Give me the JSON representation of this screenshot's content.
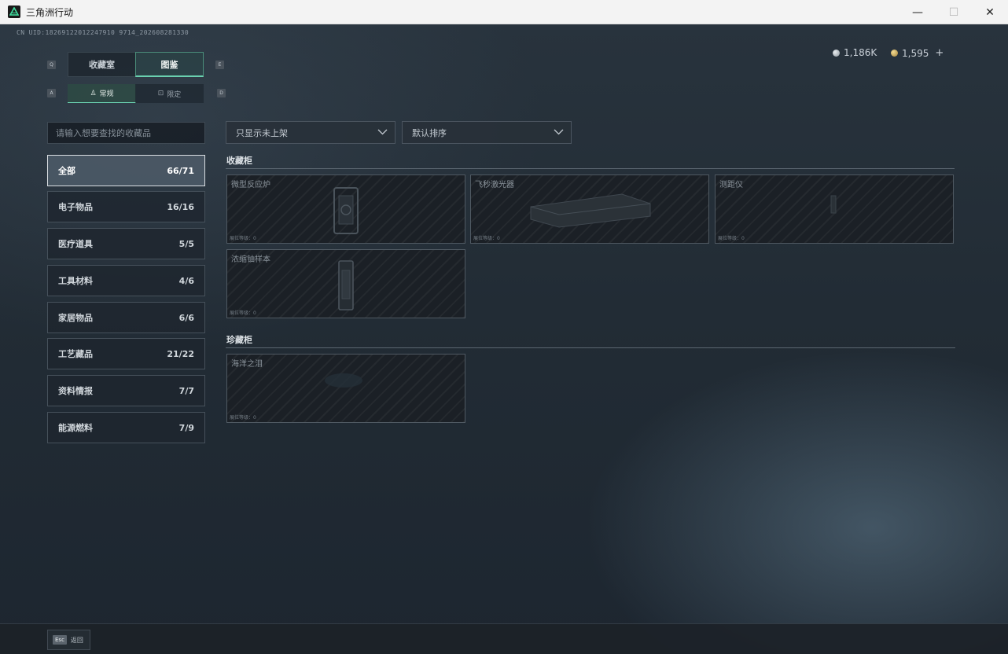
{
  "window": {
    "title": "三角洲行动",
    "minimize_glyph": "—",
    "maximize_glyph": "☐",
    "close_glyph": "✕"
  },
  "header": {
    "cnuid": "CN UID:18269122012247910 9714_202608281330",
    "currency_1": "1,186K",
    "currency_2": "1,595",
    "add_glyph": "+"
  },
  "tabs": {
    "main": [
      {
        "label": "收藏室",
        "key": "Q"
      },
      {
        "label": "图鉴",
        "key": "E"
      }
    ],
    "sub": [
      {
        "label": "常规",
        "icon": "cup-icon",
        "key": "A"
      },
      {
        "label": "限定",
        "icon": "image-icon",
        "key": "D"
      }
    ]
  },
  "search": {
    "placeholder": "请输入想要查找的收藏品",
    "value": ""
  },
  "filters": {
    "show_filter": "只显示未上架",
    "sort": "默认排序"
  },
  "categories": [
    {
      "label": "全部",
      "count": "66/71",
      "active": true
    },
    {
      "label": "电子物品",
      "count": "16/16"
    },
    {
      "label": "医疗道具",
      "count": "5/5"
    },
    {
      "label": "工具材料",
      "count": "4/6"
    },
    {
      "label": "家居物品",
      "count": "6/6"
    },
    {
      "label": "工艺藏品",
      "count": "21/22"
    },
    {
      "label": "资料情报",
      "count": "7/7"
    },
    {
      "label": "能源燃料",
      "count": "7/9"
    }
  ],
  "sections": [
    {
      "title": "收藏柜",
      "items": [
        {
          "name": "微型反应炉",
          "level": "展位等级：0"
        },
        {
          "name": "飞秒激光器",
          "level": "展位等级：0"
        },
        {
          "name": "测距仪",
          "level": "展位等级：0"
        },
        {
          "name": "浓缩铀样本",
          "level": "展位等级：0"
        }
      ]
    },
    {
      "title": "珍藏柜",
      "items": [
        {
          "name": "海洋之泪",
          "level": "展位等级：0"
        }
      ]
    }
  ],
  "footer": {
    "esc_key": "Esc",
    "back_label": "返回"
  },
  "colors": {
    "accent": "#6ad1b0",
    "background": "#222c35"
  }
}
